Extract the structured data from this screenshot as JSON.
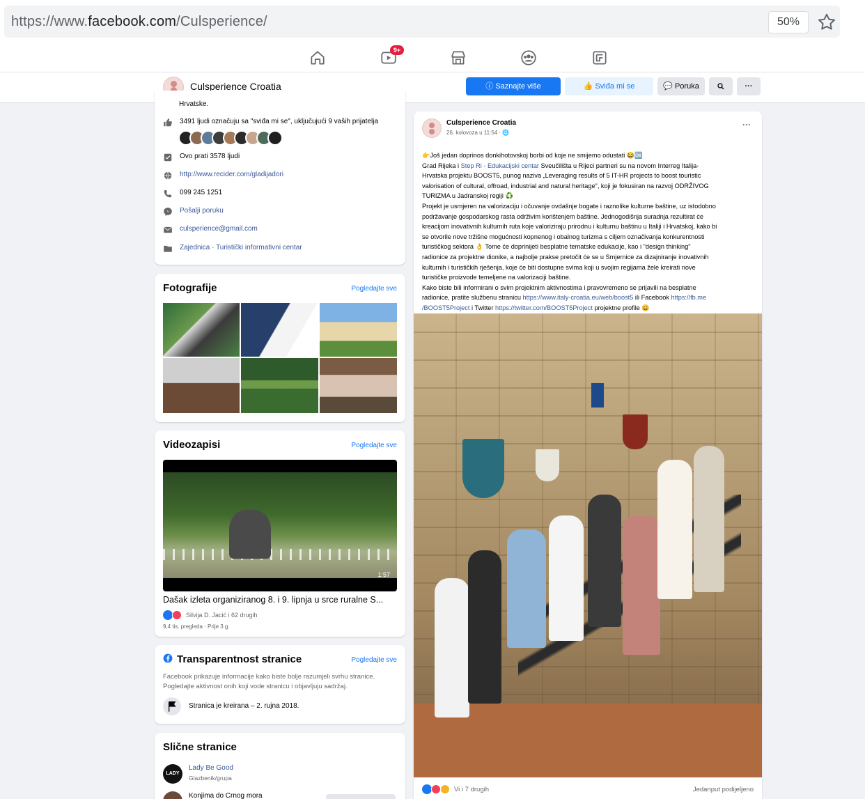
{
  "browser": {
    "url_prefix": "https://www.",
    "url_domain": "facebook.com",
    "url_path": "/Culsperience/",
    "zoom": "50%"
  },
  "nav": {
    "video_badge": "9+",
    "icons": [
      "home-icon",
      "watch-icon",
      "marketplace-icon",
      "groups-icon",
      "gaming-icon"
    ]
  },
  "page_header": {
    "name": "Culsperience Croatia",
    "learn_more": "Saznajte više",
    "like": "Sviđa mi se",
    "message": "Poruka"
  },
  "about": {
    "cut_text": "Hrvatske.",
    "likes": "3491 ljudi označuju sa \"sviđa mi se\", uključujući 9 vaših prijatelja",
    "follows": "Ovo prati 3578 ljudi",
    "website": "http://www.recider.com/gladijadori",
    "phone": "099 245 1251",
    "send_message": "Pošalji poruku",
    "email": "culsperience@gmail.com",
    "categories": "Zajednica · Turistički informativni centar"
  },
  "photos": {
    "title": "Fotografije",
    "see_all": "Pogledajte sve"
  },
  "videos": {
    "title": "Videozapisi",
    "see_all": "Pogledajte sve",
    "duration": "1:57",
    "video_title": "Dašak izleta organiziranog 8. i 9. lipnja u srce ruralne S...",
    "reactors": "Silvija D. Jacić i 62 drugih",
    "meta": "9,4 tis. pregleda · Prije 3 g."
  },
  "transparency": {
    "title": "Transparentnost stranice",
    "see_all": "Pogledajte sve",
    "desc1": "Facebook prikazuje informacije kako biste bolje razumjeli svrhu stranice.",
    "desc2": "Pogledajte aktivnost onih koji vode stranicu i objavljuju sadržaj.",
    "created": "Stranica je kreirana – 2. rujna 2018."
  },
  "similar": {
    "title": "Slične stranice",
    "items": [
      {
        "name": "Lady Be Good",
        "sub": "Glazbenik/grupa"
      },
      {
        "name": "Konjima do Crnog mora",
        "sub": ""
      }
    ]
  },
  "post": {
    "author": "Culsperience Croatia",
    "time": "26. kolovoza u 11:54 ·",
    "l1": "👉Još jedan doprinos donkihotovskoj borbi od koje ne smijemo odustati 😂🆗",
    "l2a": "Grad Rijeka i ",
    "l2link": "Step Ri - Edukacijski centar",
    "l2b": " Sveučilišta u Rijeci partneri su na novom Interreg Italija-",
    "l3": "Hrvatska projektu BOOST5, punog naziva „Leveraging results of 5 IT-HR projects to boost touristic",
    "l4": "valorisation of cultural, offroad, industrial and natural heritage\", koji je fokusiran na razvoj ODRŽIVOG",
    "l5": "TURIZMA u Jadranskoj regiji ♻️",
    "l6": "Projekt je usmjeren na valorizaciju i očuvanje ovdašnje bogate i raznolike kulturne baštine, uz istodobno",
    "l7": "podržavanje gospodarskog rasta održivim korištenjem baštine. Jednogodišnja suradnja rezultirat će",
    "l8": "kreacijom inovativnih kulturnih ruta koje valoriziraju prirodnu i kulturnu baštinu u Italiji i Hrvatskoj, kako bi",
    "l9": "se otvorile nove tržišne mogućnosti kopnenog i obalnog turizma s ciljem označivanja konkurentnosti",
    "l10": "turističkog sektora 👌 Tome će doprinijeti besplatne tematske edukacije, kao i \"design thinking\"",
    "l11": "radionice za projektne dionike, a najbolje prakse pretočit će se u Smjernice za dizajniranje inovativnih",
    "l12": "kulturnih i turističkih rješenja, koje će biti dostupne svima koji u svojim regijama žele kreirati nove",
    "l13": "turističke proizvode temeljene na valorizaciji baštine.",
    "l14": "Kako biste bili informirani o svim projektnim aktivnostima i pravovremeno se prijavili na besplatne",
    "l15a": "radionice, pratite službenu stranicu ",
    "l15link": "https://www.italy-croatia.eu/web/boost5",
    "l15b": " ili Facebook ",
    "l15link2": "https://fb.me",
    "l16link": "/BOOST5Project",
    "l16a": " i Twitter ",
    "l16link2": "https://twitter.com/BOOST5Project",
    "l16b": " projektne profile 😄",
    "reactions": "Vi i 7 drugih",
    "shares": "Jedanput podijeljeno"
  },
  "colors": {
    "fb_blue": "#1877f2",
    "link": "#385898",
    "bg": "#f0f2f5"
  }
}
